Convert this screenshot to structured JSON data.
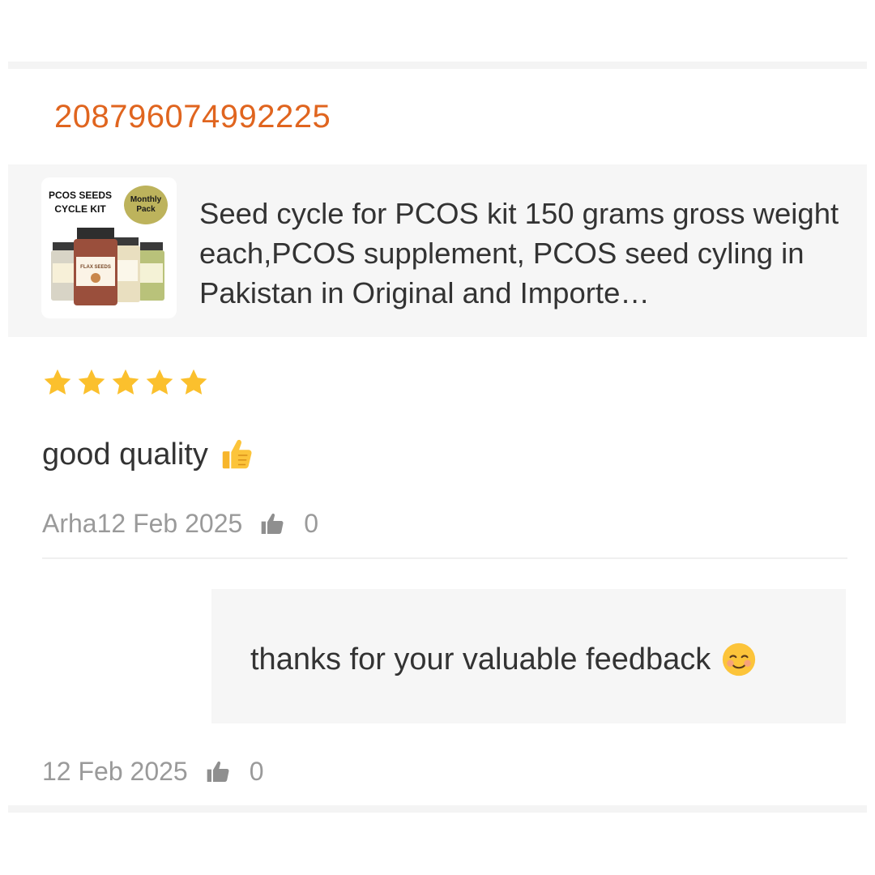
{
  "order": {
    "id": "208796074992225"
  },
  "product": {
    "title": "Seed cycle for PCOS kit 150 grams gross weight each,PCOS supplement, PCOS seed cyling in Pakistan in Original and Importe…",
    "thumbnail": {
      "kit_title": "PCOS SEEDS CYCLE KIT",
      "badge": "Monthly Pack",
      "jar_label": "FLAX SEEDS"
    }
  },
  "review": {
    "rating": 5,
    "rating_max": 5,
    "text": "good quality",
    "emoji": "thumbs-up",
    "author_date": "Arha12 Feb 2025",
    "likes": "0"
  },
  "reply": {
    "text": "thanks for your valuable feedback",
    "emoji": "smiling-face",
    "date": "12 Feb 2025",
    "likes": "0"
  },
  "colors": {
    "order_id": "#e0651f",
    "star": "#fbc02d",
    "panel_bg": "#f6f6f6",
    "meta_text": "#9a9a9a"
  }
}
